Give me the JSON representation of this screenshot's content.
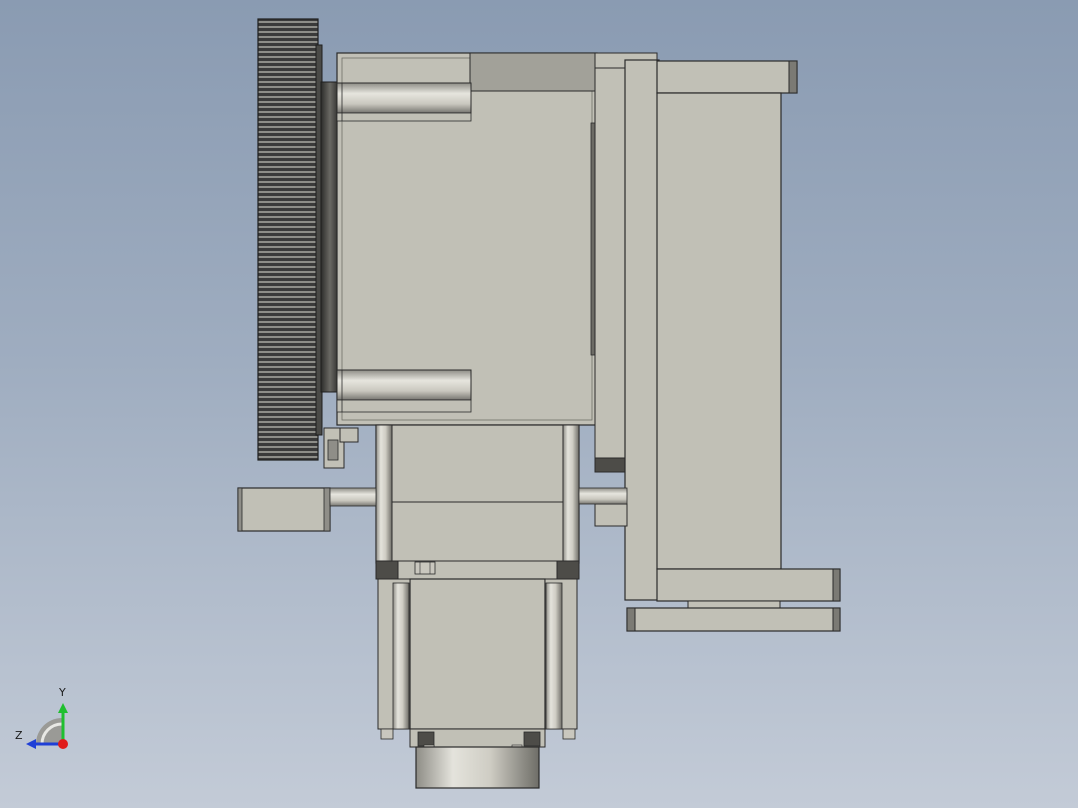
{
  "viewport": {
    "background_top": "#8a9bb2",
    "background_bottom": "#c3cbd7"
  },
  "colors": {
    "body": "#c1c0b6",
    "body_shade": "#a9a89e",
    "edge": "#2a2a2a",
    "dark": "#3b3b38",
    "gear": "#3a3a3a",
    "gear_light": "#9a9a94",
    "metal": "#b8b6ac"
  },
  "triad": {
    "y_label": "Y",
    "z_label": "Z",
    "y_color": "#1fbf2f",
    "z_color": "#1f3fd6",
    "x_color": "#e01b1b"
  }
}
